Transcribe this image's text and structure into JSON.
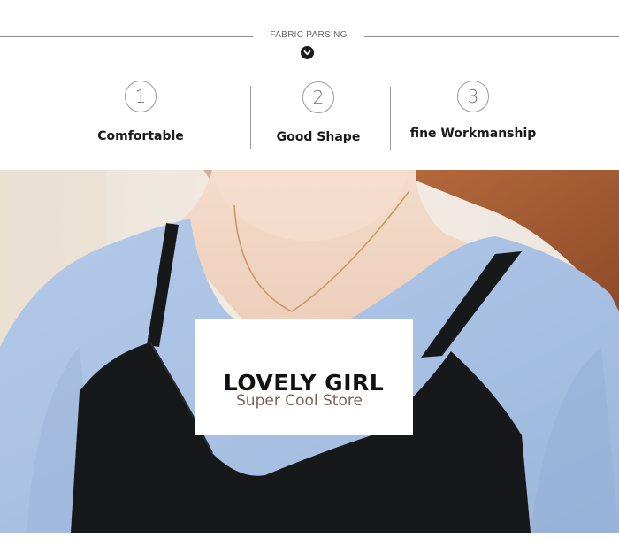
{
  "header": {
    "section_title": "FABRIC PARSING",
    "arrow_icon": "chevron-down-icon"
  },
  "features": [
    {
      "number": "1",
      "label": "Comfortable"
    },
    {
      "number": "2",
      "label": "Good Shape"
    },
    {
      "number": "3",
      "label": "fine Workmanship"
    }
  ],
  "banner": {
    "title": "LOVELY GIRL",
    "subtitle": "Super Cool Store"
  },
  "colors": {
    "blouse": "#a9c1e3",
    "camisole": "#16181a",
    "skin": "#f1d6c4",
    "hair": "#a85f36"
  }
}
